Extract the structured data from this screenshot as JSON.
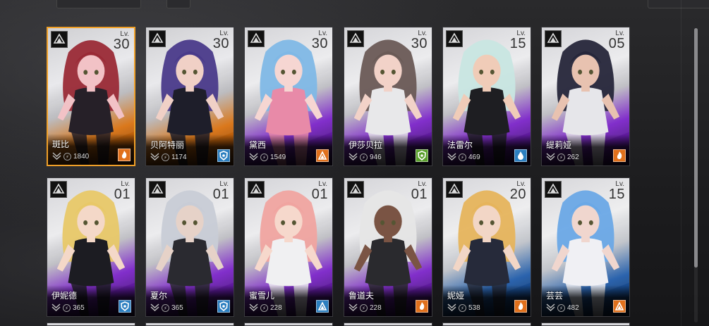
{
  "level_label": "Lv.",
  "colors": {
    "orange": "#e0701c",
    "blue": "#2c7fc0",
    "green": "#5aa02c",
    "purple": "#7a2bd0",
    "selected_border": "#f0a028"
  },
  "cards": [
    {
      "name": "斑比",
      "level": "30",
      "power": "1840",
      "bg": "orange",
      "element": "orange",
      "selected": true,
      "skin": "#f2c2c6",
      "hair": "#9a2a36",
      "outfit": "#262028",
      "icon": "flame-icon"
    },
    {
      "name": "贝阿特丽",
      "level": "30",
      "power": "1174",
      "bg": "orange",
      "element": "blue",
      "selected": false,
      "skin": "#f0d0c6",
      "hair": "#4a3a8a",
      "outfit": "#1e1e2a",
      "icon": "shield-icon"
    },
    {
      "name": "黛西",
      "level": "30",
      "power": "1549",
      "bg": "purple",
      "element": "orange",
      "selected": false,
      "skin": "#f6d6d2",
      "hair": "#7fb8e6",
      "outfit": "#e88aa8",
      "icon": "triangle-icon"
    },
    {
      "name": "伊莎贝拉",
      "level": "30",
      "power": "946",
      "bg": "purple",
      "element": "green",
      "selected": false,
      "skin": "#f2d2c8",
      "hair": "#6a5a56",
      "outfit": "#e8e8ea",
      "icon": "shield-icon"
    },
    {
      "name": "法雷尔",
      "level": "15",
      "power": "469",
      "bg": "purple",
      "element": "blue",
      "selected": false,
      "skin": "#f0ccb8",
      "hair": "#c8e6e2",
      "outfit": "#1e1e22",
      "icon": "drop-icon"
    },
    {
      "name": "缇莉娅",
      "level": "05",
      "power": "262",
      "bg": "purple",
      "element": "orange",
      "selected": false,
      "skin": "#e8c2b0",
      "hair": "#26263a",
      "outfit": "#e6e6ea",
      "icon": "flame-icon"
    },
    {
      "name": "伊妮德",
      "level": "01",
      "power": "365",
      "bg": "purple",
      "element": "blue",
      "selected": false,
      "skin": "#f4d8c8",
      "hair": "#e8c868",
      "outfit": "#1c1c22",
      "icon": "shield-icon"
    },
    {
      "name": "夏尔",
      "level": "01",
      "power": "365",
      "bg": "purple",
      "element": "blue",
      "selected": false,
      "skin": "#e6d2c8",
      "hair": "#c8ccd6",
      "outfit": "#2a2a30",
      "icon": "shield-icon"
    },
    {
      "name": "蜜雪儿",
      "level": "01",
      "power": "228",
      "bg": "purple",
      "element": "blue",
      "selected": false,
      "skin": "#f6d8cc",
      "hair": "#f0a4a0",
      "outfit": "#f0f0f2",
      "icon": "triangle-icon"
    },
    {
      "name": "鲁道夫",
      "level": "01",
      "power": "228",
      "bg": "purple",
      "element": "orange",
      "selected": false,
      "skin": "#7a5444",
      "hair": "#e6e6e6",
      "outfit": "#2a2a2e",
      "icon": "flame-icon"
    },
    {
      "name": "妮娅",
      "level": "20",
      "power": "538",
      "bg": "blue",
      "element": "orange",
      "selected": false,
      "skin": "#f2d6c6",
      "hair": "#e6b45c",
      "outfit": "#262a3a",
      "icon": "flame-icon"
    },
    {
      "name": "芸芸",
      "level": "15",
      "power": "482",
      "bg": "blue",
      "element": "orange",
      "selected": false,
      "skin": "#f0d6ce",
      "hair": "#6aa8e6",
      "outfit": "#f0f0f4",
      "icon": "triangle-icon"
    }
  ]
}
